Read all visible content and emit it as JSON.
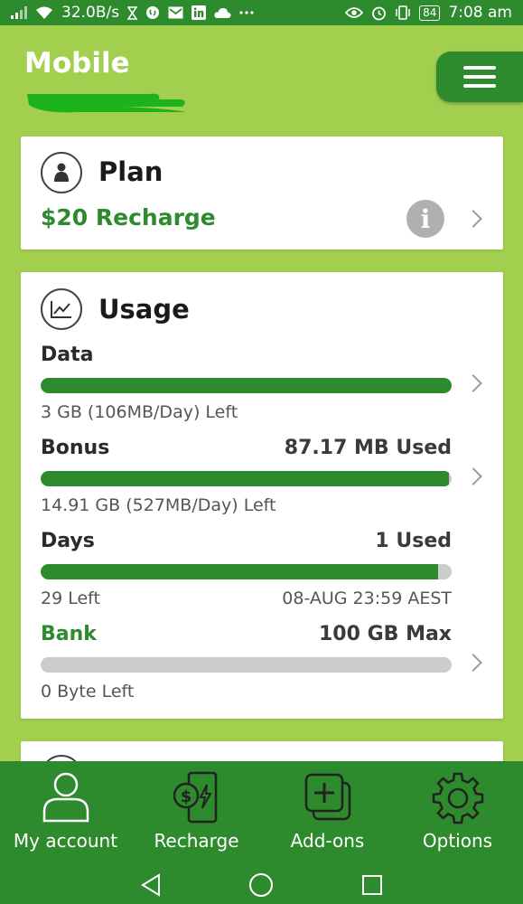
{
  "status_bar": {
    "speed": "32.0B/s",
    "battery": "84",
    "time": "7:08 am"
  },
  "header": {
    "title": "Mobile"
  },
  "plan_card": {
    "title": "Plan",
    "plan_name": "$20 Recharge"
  },
  "usage_card": {
    "title": "Usage",
    "data": {
      "label": "Data",
      "remaining": "3 GB (106MB/Day) Left",
      "fill_fraction": 1.0
    },
    "bonus": {
      "label": "Bonus",
      "used": "87.17 MB Used",
      "remaining": "14.91 GB (527MB/Day) Left",
      "fill_fraction": 0.994
    },
    "days": {
      "label": "Days",
      "used": "1 Used",
      "remaining": "29 Left",
      "expiry": "08-AUG 23:59 AEST",
      "fill_fraction": 0.967
    },
    "bank": {
      "label": "Bank",
      "max": "100 GB Max",
      "remaining": "0 Byte Left",
      "fill_fraction": 0.0
    }
  },
  "bottom_nav": {
    "items": [
      {
        "label": "My account",
        "icon": "person-icon"
      },
      {
        "label": "Recharge",
        "icon": "phone-recharge-icon"
      },
      {
        "label": "Add-ons",
        "icon": "add-on-icon"
      },
      {
        "label": "Options",
        "icon": "gear-icon"
      }
    ]
  },
  "colors": {
    "brand_green": "#2d8a2d",
    "background_lime": "#a3cf4f"
  }
}
